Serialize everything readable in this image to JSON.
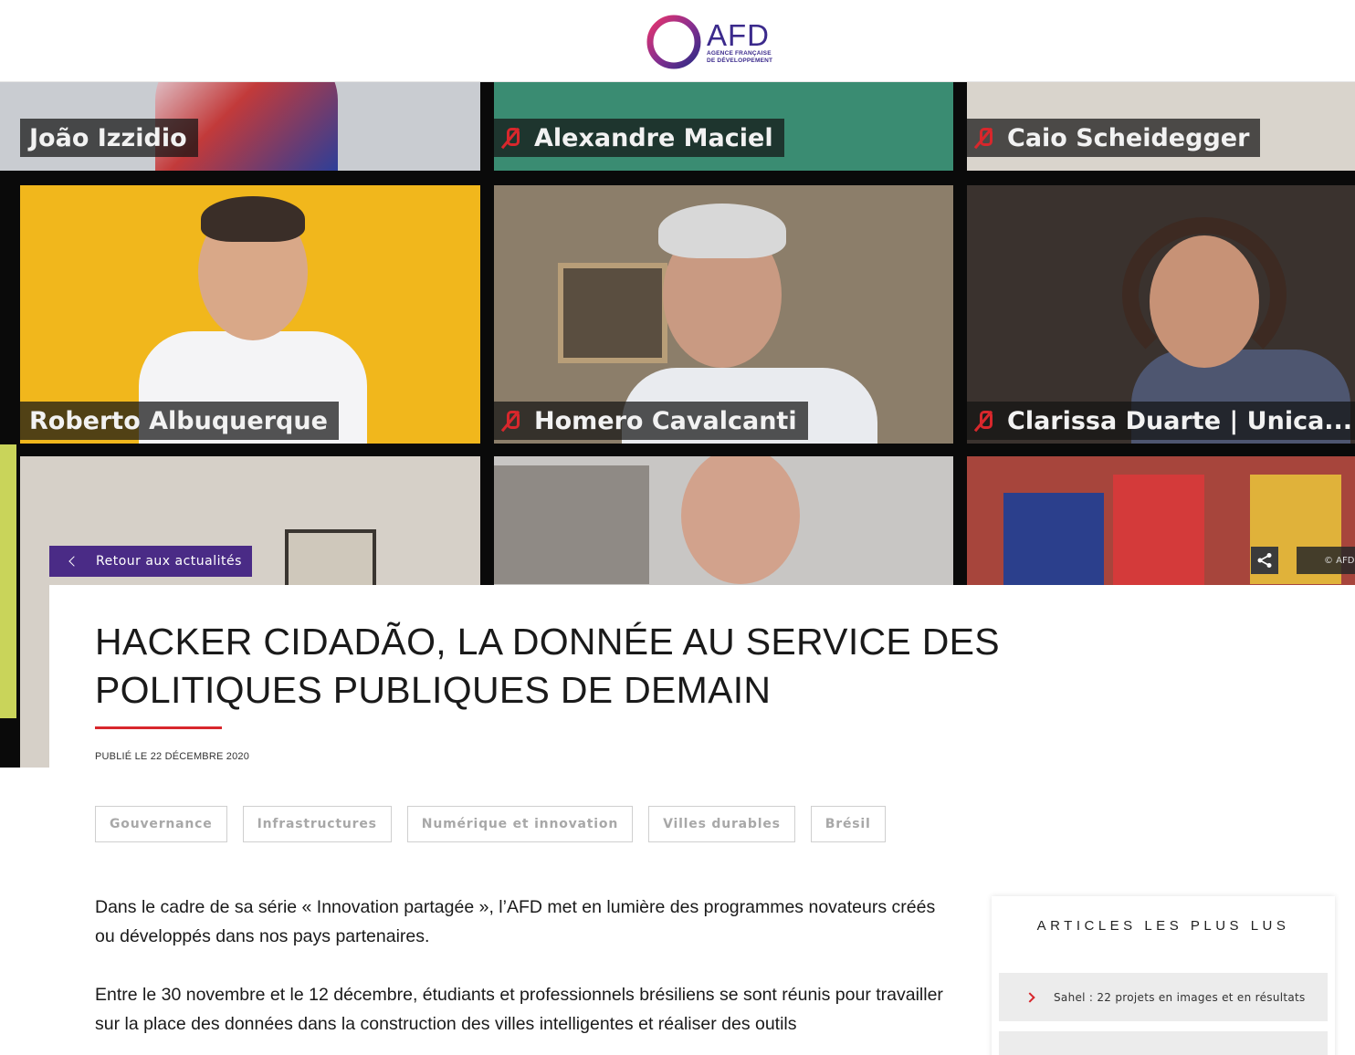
{
  "header": {
    "logo_acronym": "AFD",
    "logo_line1": "AGENCE FRANÇAISE",
    "logo_line2": "DE DÉVELOPPEMENT"
  },
  "hero": {
    "participants": [
      {
        "name": "João Izzidio",
        "muted": false
      },
      {
        "name": "Alexandre Maciel",
        "muted": true
      },
      {
        "name": "Caio Scheidegger",
        "muted": true
      },
      {
        "name": "Roberto Albuquerque",
        "muted": false
      },
      {
        "name": "Homero Cavalcanti",
        "muted": true
      },
      {
        "name": "Clarissa Duarte | Unica...",
        "muted": true
      }
    ],
    "back_label": "Retour aux actualités",
    "credit": "© AFD"
  },
  "article": {
    "title": "HACKER CIDADÃO, LA DONNÉE AU SERVICE DES POLITIQUES PUBLIQUES DE DEMAIN",
    "published": "PUBLIÉ LE 22 DÉCEMBRE 2020",
    "tags": [
      "Gouvernance",
      "Infrastructures",
      "Numérique et innovation",
      "Villes durables",
      "Brésil"
    ],
    "paragraph1": "Dans le cadre de sa série « Innovation partagée », l’AFD met en lumière des programmes novateurs créés ou développés dans nos pays partenaires.",
    "paragraph2": "Entre le 30 novembre et le 12 décembre, étudiants et professionnels brésiliens se sont réunis pour travailler sur la place des données dans la construction des villes intelligentes et réaliser des outils"
  },
  "sidebar": {
    "title": "ARTICLES LES PLUS LUS",
    "items": [
      {
        "label": "Sahel : 22 projets en images et en résultats"
      }
    ]
  },
  "colors": {
    "brand_purple": "#4a2b86",
    "accent_red": "#d8272c"
  }
}
